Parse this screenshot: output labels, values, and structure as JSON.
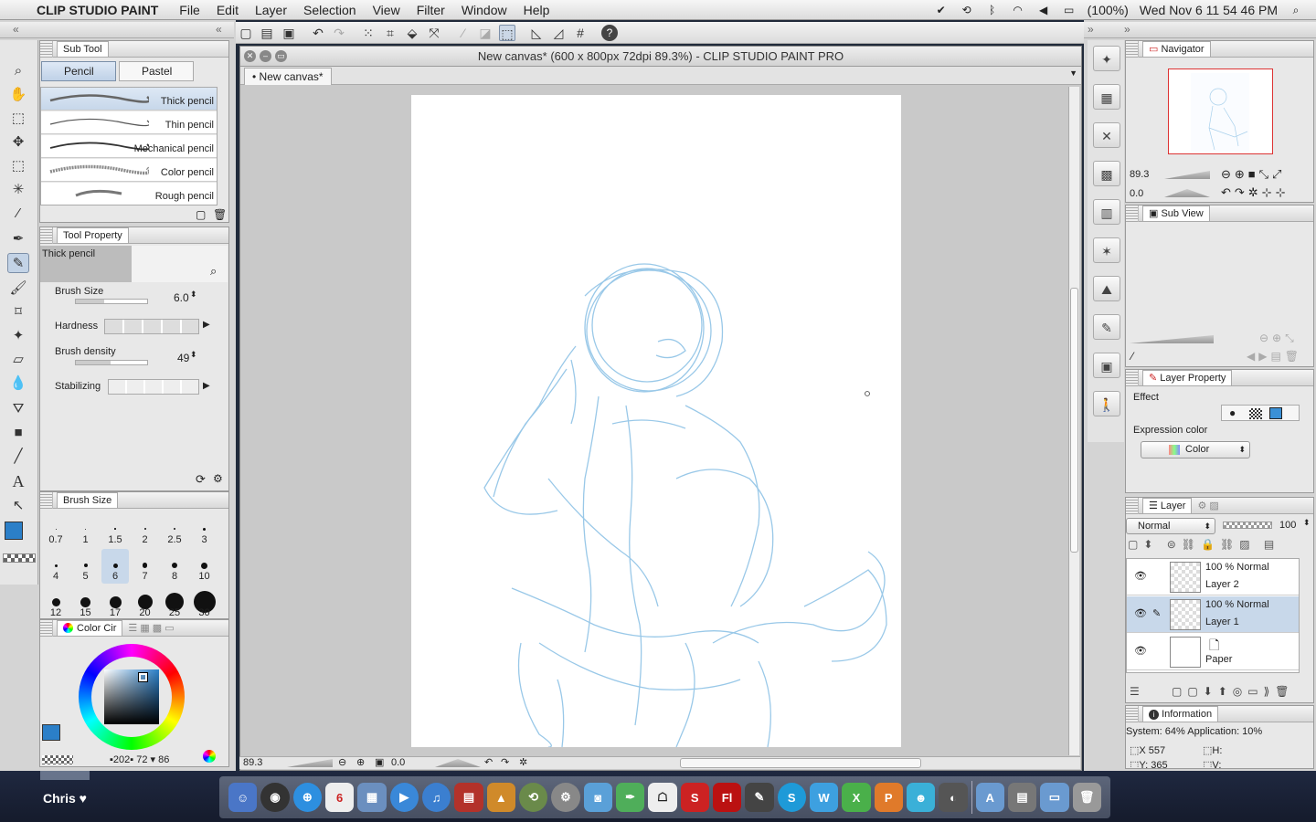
{
  "menubar": {
    "app": "CLIP STUDIO PAINT",
    "items": [
      "File",
      "Edit",
      "Layer",
      "Selection",
      "View",
      "Filter",
      "Window",
      "Help"
    ],
    "battery": "(100%)",
    "clock": "Wed Nov 6  11 54 46 PM"
  },
  "subtool": {
    "tab": "Sub Tool",
    "tabs": [
      "Pencil",
      "Pastel"
    ],
    "brushes": [
      "Thick pencil",
      "Thin pencil",
      "Mechanical pencil",
      "Color pencil",
      "Rough pencil"
    ]
  },
  "toolprop": {
    "tab": "Tool Property",
    "name": "Thick pencil",
    "brush_size_label": "Brush Size",
    "brush_size": "6.0",
    "hardness_label": "Hardness",
    "density_label": "Brush density",
    "density": "49",
    "stabilizing_label": "Stabilizing"
  },
  "brushsize": {
    "tab": "Brush Size",
    "sizes": [
      "0.7",
      "1",
      "1.5",
      "2",
      "2.5",
      "3",
      "4",
      "5",
      "6",
      "7",
      "8",
      "10",
      "12",
      "15",
      "17",
      "20",
      "25",
      "30"
    ]
  },
  "color": {
    "tab": "Color Cir",
    "r": "202",
    "g": "72",
    "b": "86",
    "main": "#2b7fc8"
  },
  "canvas": {
    "title": "New canvas* (600 x 800px 72dpi 89.3%)  - CLIP STUDIO PAINT PRO",
    "tab": "New canvas*",
    "zoom": "89.3",
    "rotate": "0.0"
  },
  "navigator": {
    "tab": "Navigator",
    "zoom": "89.3",
    "rotate": "0.0"
  },
  "subview": {
    "tab": "Sub View"
  },
  "layerprop": {
    "tab": "Layer Property",
    "effect": "Effect",
    "expr_label": "Expression color",
    "expr": "Color"
  },
  "layers": {
    "tab": "Layer",
    "blend": "Normal",
    "opacity": "100",
    "rows": [
      {
        "mode": "100 % Normal",
        "name": "Layer 2"
      },
      {
        "mode": "100 % Normal",
        "name": "Layer 1"
      },
      {
        "mode": "",
        "name": "Paper"
      }
    ]
  },
  "info": {
    "tab": "Information",
    "system": "System: 64% Application: 10%",
    "x": "X 557",
    "y": "Y: 365",
    "h": "H:",
    "v": "V:"
  },
  "dock": {
    "user": "Chris ♥",
    "calendar_day": "6"
  }
}
